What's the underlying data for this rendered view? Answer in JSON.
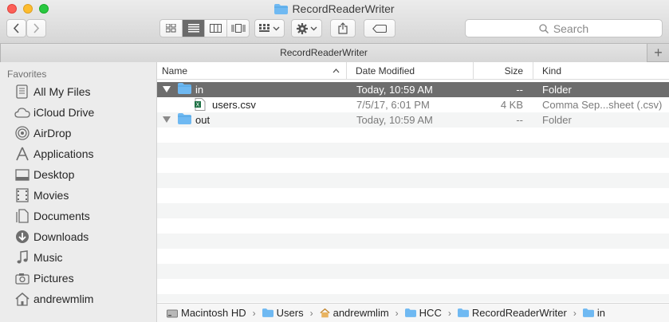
{
  "window": {
    "title": "RecordReaderWriter"
  },
  "toolbar": {
    "search_placeholder": "Search"
  },
  "tabbar": {
    "tab_label": "RecordReaderWriter",
    "add_label": "+"
  },
  "sidebar": {
    "heading": "Favorites",
    "items": [
      {
        "label": "All My Files",
        "icon": "all-files-icon"
      },
      {
        "label": "iCloud Drive",
        "icon": "cloud-icon"
      },
      {
        "label": "AirDrop",
        "icon": "airdrop-icon"
      },
      {
        "label": "Applications",
        "icon": "applications-icon"
      },
      {
        "label": "Desktop",
        "icon": "desktop-icon"
      },
      {
        "label": "Movies",
        "icon": "movies-icon"
      },
      {
        "label": "Documents",
        "icon": "documents-icon"
      },
      {
        "label": "Downloads",
        "icon": "downloads-icon"
      },
      {
        "label": "Music",
        "icon": "music-icon"
      },
      {
        "label": "Pictures",
        "icon": "pictures-icon"
      },
      {
        "label": "andrewmlim",
        "icon": "home-icon"
      }
    ]
  },
  "columns": {
    "name": "Name",
    "date": "Date Modified",
    "size": "Size",
    "kind": "Kind"
  },
  "files": [
    {
      "name": "in",
      "date": "Today, 10:59 AM",
      "size": "--",
      "kind": "Folder",
      "type": "folder",
      "expanded": true,
      "selected": true
    },
    {
      "name": "users.csv",
      "date": "7/5/17, 6:01 PM",
      "size": "4 KB",
      "kind": "Comma Sep...sheet (.csv)",
      "type": "csv",
      "indent": true
    },
    {
      "name": "out",
      "date": "Today, 10:59 AM",
      "size": "--",
      "kind": "Folder",
      "type": "folder",
      "expanded": true
    }
  ],
  "pathbar": [
    "Macintosh HD",
    "Users",
    "andrewmlim",
    "HCC",
    "RecordReaderWriter",
    "in"
  ],
  "colors": {
    "selection": "#6d6d6d",
    "folder": "#6fb9f2",
    "stripe": "#f4f5f5"
  }
}
